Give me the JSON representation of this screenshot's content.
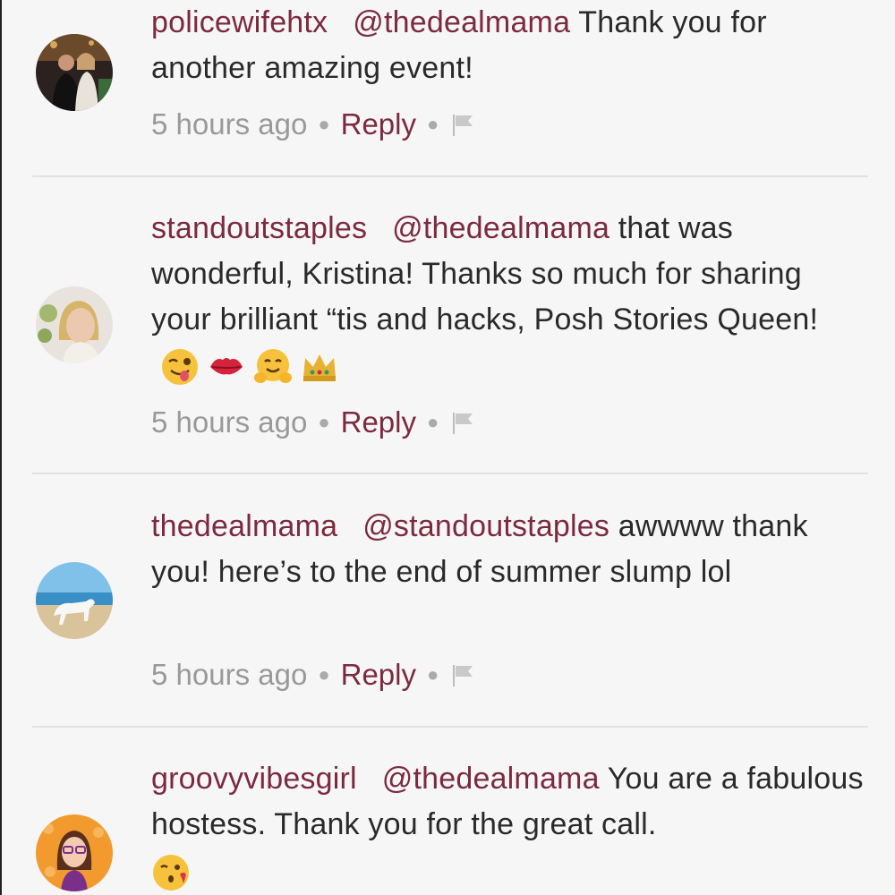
{
  "comments": [
    {
      "username": "policewifehtx",
      "mention": "@thedealmama",
      "text": " Thank you for another amazing event!",
      "time": "5 hours ago",
      "reply": "Reply",
      "avatar_icon": "couple-photo-avatar"
    },
    {
      "username": "standoutstaples",
      "mention": "@thedealmama",
      "text": " that was wonderful, Kristina! Thanks so much for sharing your brilliant “tis and hacks, Posh Stories Queen!",
      "emojis": [
        "winking-tongue-emoji",
        "kiss-lips-emoji",
        "hugging-face-emoji",
        "crown-emoji"
      ],
      "time": "5 hours ago",
      "reply": "Reply",
      "avatar_icon": "woman-portrait-avatar"
    },
    {
      "username": "thedealmama",
      "mention": "@standoutstaples",
      "text": " awwww thank you! here’s to the end of summer slump lol",
      "time": "5 hours ago",
      "reply": "Reply",
      "avatar_icon": "white-horse-beach-avatar"
    },
    {
      "username": "groovyvibesgirl",
      "mention": "@thedealmama",
      "text": " You are a fabulous hostess. Thank you for the great call.",
      "emojis": [
        "blowing-kiss-emoji"
      ],
      "avatar_icon": "cartoon-girl-avatar"
    }
  ],
  "colors": {
    "accent": "#7c2a3f",
    "text": "#2a2a2a",
    "meta": "#999999",
    "background": "#f7f6f7"
  }
}
